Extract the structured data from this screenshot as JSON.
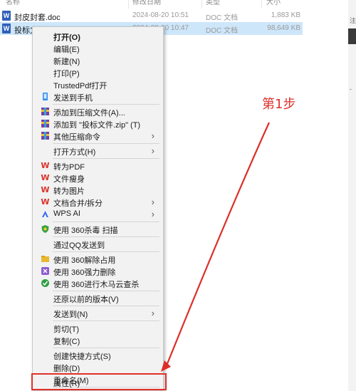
{
  "explorer": {
    "columns": {
      "name": "名称",
      "date": "修改日期",
      "type": "类型",
      "size": "大小"
    },
    "files": [
      {
        "name": "封皮封套.doc",
        "date": "2024-08-20 10:51",
        "type": "DOC 文档",
        "size": "1,883 KB",
        "icon": "W"
      },
      {
        "name": "投标文件.doc",
        "date": "2024-08-20 10:47",
        "type": "DOC 文档",
        "size": "98,649 KB",
        "icon": "W"
      }
    ]
  },
  "right_edge": {
    "glyph_top": "注",
    "glyph_mid": "-"
  },
  "context_menu": {
    "items": [
      {
        "label": "打开(O)",
        "icon": ""
      },
      {
        "label": "编辑(E)",
        "icon": ""
      },
      {
        "label": "新建(N)",
        "icon": ""
      },
      {
        "label": "打印(P)",
        "icon": ""
      },
      {
        "label": "TrustedPdf打开",
        "icon": ""
      },
      {
        "label": "发送到手机",
        "icon": "phone-icon"
      },
      {
        "label": "添加到压缩文件(A)...",
        "icon": "archive-icon"
      },
      {
        "label": "添加到 \"投标文件.zip\" (T)",
        "icon": "archive-icon"
      },
      {
        "label": "其他压缩命令",
        "icon": "archive-icon"
      },
      {
        "label": "打开方式(H)",
        "icon": ""
      },
      {
        "label": "转为PDF",
        "icon": "wps-icon"
      },
      {
        "label": "文件瘦身",
        "icon": "wps-icon"
      },
      {
        "label": "转为图片",
        "icon": "wps-icon"
      },
      {
        "label": "文档合并/拆分",
        "icon": "wps-icon"
      },
      {
        "label": "WPS AI",
        "icon": "wps-ai-icon"
      },
      {
        "label": "使用 360杀毒 扫描",
        "icon": "shield-icon"
      },
      {
        "label": "通过QQ发送到",
        "icon": ""
      },
      {
        "label": "使用 360解除占用",
        "icon": "folder-icon"
      },
      {
        "label": "使用 360强力删除",
        "icon": "delete-icon"
      },
      {
        "label": "使用 360进行木马云查杀",
        "icon": "scan-icon"
      },
      {
        "label": "还原以前的版本(V)",
        "icon": ""
      },
      {
        "label": "发送到(N)",
        "icon": ""
      },
      {
        "label": "剪切(T)",
        "icon": ""
      },
      {
        "label": "复制(C)",
        "icon": ""
      },
      {
        "label": "创建快捷方式(S)",
        "icon": ""
      },
      {
        "label": "删除(D)",
        "icon": ""
      },
      {
        "label": "重命名(M)",
        "icon": ""
      },
      {
        "label": "属性(R)",
        "icon": ""
      }
    ],
    "arrow_glyph": "›",
    "wps_glyph": "W"
  },
  "annotation": {
    "step_label": "第1步",
    "color": "#dc2f2a"
  }
}
